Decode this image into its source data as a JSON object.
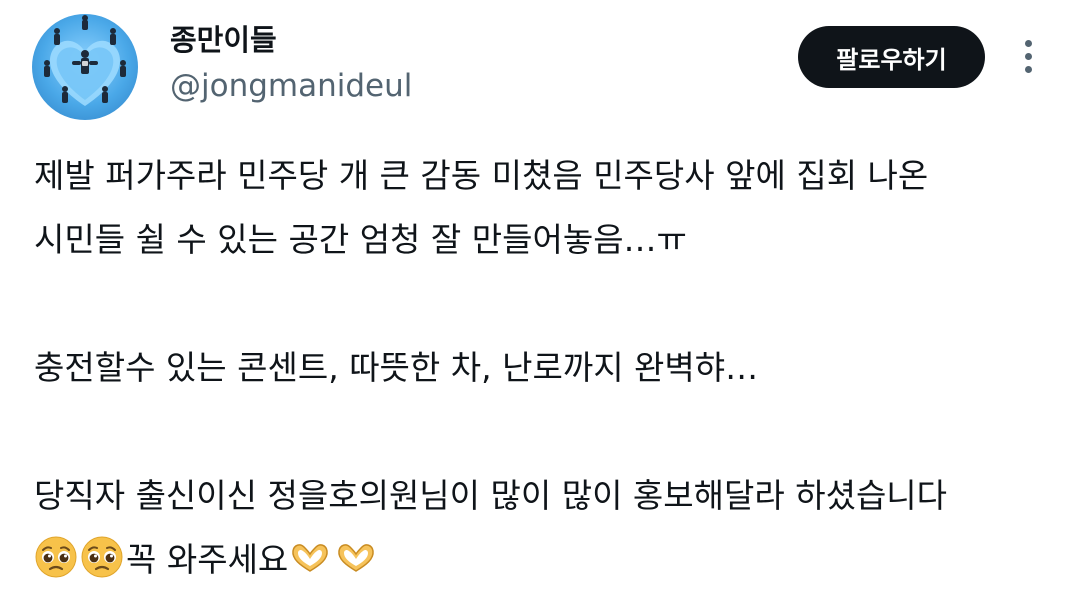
{
  "author": {
    "display_name": "종만이들",
    "handle": "@jongmanideul"
  },
  "actions": {
    "follow_label": "팔로우하기",
    "more_icon": "more-vertical-icon"
  },
  "tweet": {
    "lines": [
      "제발 퍼가주라 민주당 개 큰 감동 미쳤음 민주당사 앞에 집회 나온",
      "시민들 쉴 수 있는 공간 엄청 잘 만들어놓음…ㅠ",
      "",
      "충전할수 있는 콘센트, 따뜻한 차, 난로까지 완벽햐…",
      "",
      "당직자 출신이신 정을호의원님이 많이 많이 홍보해달라 하셨습니다",
      "꼭 와주세요"
    ],
    "emojis": [
      "pleading-face-icon",
      "pleading-face-icon",
      "heart-hands-icon",
      "heart-hands-icon"
    ]
  },
  "colors": {
    "text_primary": "#0f1419",
    "text_secondary": "#536471",
    "button_bg": "#0f1419",
    "button_text": "#ffffff"
  }
}
